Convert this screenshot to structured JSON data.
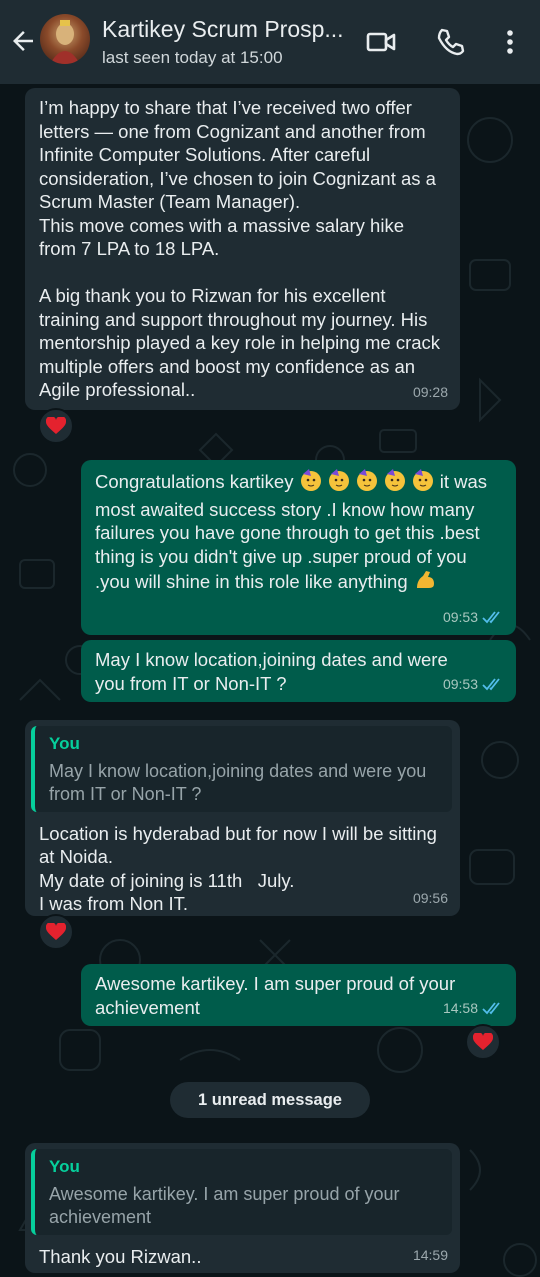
{
  "header": {
    "contact_name": "Kartikey Scrum Prosp...",
    "status": "last seen today at 15:00",
    "icons": [
      "back-arrow-icon",
      "video-call-icon",
      "voice-call-icon",
      "more-options-icon"
    ]
  },
  "colors": {
    "incoming_bubble": "#1f2c33",
    "outgoing_bubble": "#005c4b",
    "background": "#0b1418",
    "quote_accent": "#06cf9c",
    "read_ticks": "#53bdeb"
  },
  "messages": [
    {
      "direction": "in",
      "text": "I’m happy to share that I’ve received two offer letters — one from Cognizant and another from Infinite Computer Solutions. After careful consideration, I’ve chosen to join Cognizant as a Scrum Master (Team Manager).\nThis move comes with a massive salary hike from 7 LPA to 18 LPA.\n\nA big thank you to Rizwan for his excellent training and support throughout my journey. His mentorship played a key role in helping me crack multiple offers and boost my confidence as an Agile professional..",
      "time": "09:28",
      "reaction": "red-heart"
    },
    {
      "direction": "out",
      "text_part1": "Congratulations kartikey",
      "text_part2": " it was most awaited success story .I know how many failures you have gone through to get this .best thing is you didn't give up .super proud of you .you will shine in this role like anything",
      "emojis": [
        "partying-face",
        "partying-face",
        "partying-face",
        "partying-face",
        "partying-face"
      ],
      "trailing_emoji": "flexed-biceps",
      "time": "09:53",
      "status": "read"
    },
    {
      "direction": "out",
      "text": "May I know location,joining dates and were you from IT or Non-IT ?",
      "time": "09:53",
      "status": "read"
    },
    {
      "direction": "in",
      "quote_author": "You",
      "quote_text": "May I know location,joining dates and were you from IT or Non-IT ?",
      "text": "Location is hyderabad but for now I will be sitting at Noida.\nMy date of joining is 11th   July.\nI was from Non IT.",
      "time": "09:56",
      "reaction": "red-heart"
    },
    {
      "direction": "out",
      "text": "Awesome kartikey. I am super proud of your achievement",
      "time": "14:58",
      "status": "read",
      "reaction": "red-heart"
    },
    {
      "direction": "in",
      "quote_author": "You",
      "quote_text": "Awesome kartikey. I am super proud of your achievement",
      "text": "Thank you Rizwan..",
      "time": "14:59"
    }
  ],
  "unread_divider": "1 unread message"
}
